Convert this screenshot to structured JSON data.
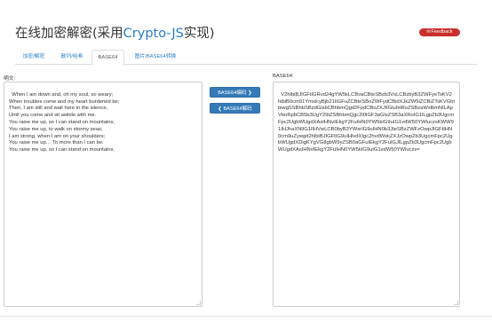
{
  "header": {
    "title_prefix": "在线加密解密(采用",
    "title_accent": "Crypto-JS",
    "title_suffix": "实现)",
    "feedback_icon": "✉",
    "feedback_label": "Feedback"
  },
  "tabs": [
    {
      "label": "加密/解密",
      "active": false
    },
    {
      "label": "散列/哈希",
      "active": false
    },
    {
      "label": "BASE64",
      "active": true
    },
    {
      "label": "图片/BASE64转换",
      "active": false
    }
  ],
  "plaintext": {
    "label": "明文:",
    "value": "When I am down and, oh my soul, so weary;\nWhen troubles come and my heart burdened be;\nThen, I am still and wait here in the silence,\nUntil you come and sit awhile with me.\nYou raise me up, so I can stand on mountains;\nYou raise me up, to walk on stormy seas;\nI am strong, when I am on your shoulders;\nYou raise me up… To more than I can be.\nYou raise me up, so I can stand on mountains;"
  },
  "buttons": {
    "encode": "BASE64编码 ❯",
    "decode": "❮ BASE64解码"
  },
  "encoded": {
    "label": "BASE64:",
    "value": "V2hlbiBJIGFtIGRvd24gYW5kLCBvaCBteSBzb3VsLCBzbyB3ZWFyeTsKV2hlbiB0cm91YmxlcyBjb21lIGFuZCBteSBoZWFydCBidXJkZW5lZCBiZTsKVGhlbiwgSSBhbSBzdGlsbCBhbmQgd2FpdCBoZXJlIGluIHRoZSBzaWxlbmNlLApVbnRpbCB5b3UgY29tZSBhbmQgc2l0IGF3aGlsZSB3aXRoIG1lLgpZb3UgcmFpc2UgbWUgdXAsIHNvIEkgY2FuIHN0YW5kIG9uIG1vdW50YWluczsKWW91IHJhaXNlIG1lIHVwLCB0byB3YWxrIG9uIHN0b3JteSBzZWFzOwpJIGFtIHN0cm9uZywgd2hlbiBJIGFtIG9uIHlvdXIgc2hvdWxkZXJzOwpZb3UgcmFpc2UgbWUgdXDigKYgVG8gbW9yZSB0aGFuIEkgY2FuIGJlLgpZb3UgcmFpc2UgbWUgdXAsIHNvIEkgY2FuIHN0YW5kIG9uIG1vdW50YWluczs="
  }
}
